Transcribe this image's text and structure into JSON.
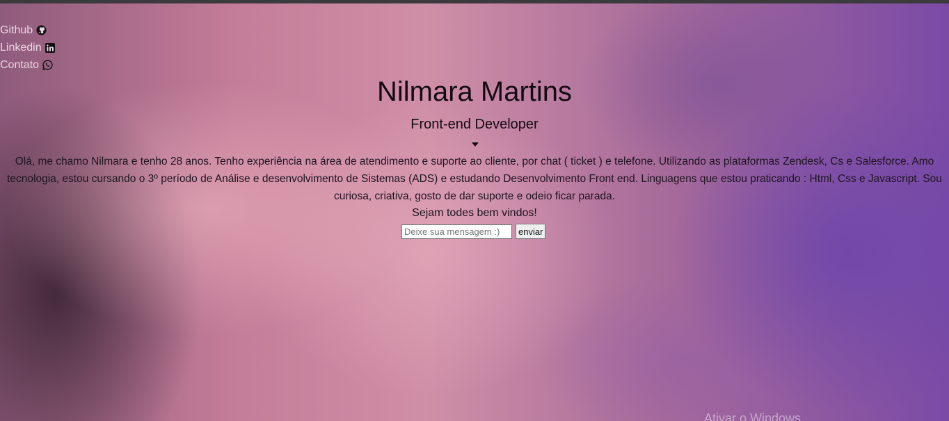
{
  "nav": {
    "items": [
      {
        "label": "Github",
        "icon": "github-icon"
      },
      {
        "label": "Linkedin",
        "icon": "linkedin-icon"
      },
      {
        "label": "Contato",
        "icon": "whatsapp-icon"
      }
    ]
  },
  "header": {
    "name": "Nilmara Martins",
    "role": "Front-end Developer"
  },
  "about": {
    "text": "Olá, me chamo Nilmara e tenho 28 anos. Tenho experiência na área de atendimento e suporte ao cliente, por chat ( ticket ) e telefone. Utilizando as plataformas Zendesk, Cs e Salesforce. Amo tecnologia, estou cursando o 3º período de Análise e desenvolvimento de Sistemas (ADS) e estudando Desenvolvimento Front end. Linguagens que estou praticando : Html, Css e Javascript. Sou curiosa, criativa, gosto de dar suporte e odeio ficar parada.",
    "welcome": "Sejam todes bem vindos!"
  },
  "form": {
    "placeholder": "Deixe sua mensagem :)",
    "value": "",
    "button_label": "enviar"
  },
  "overlay": {
    "watermark": "Ativar o Windows"
  },
  "colors": {
    "nav_text": "#ead6e2",
    "heading_text": "#140a12",
    "top_bar": "#3b3b3d"
  }
}
